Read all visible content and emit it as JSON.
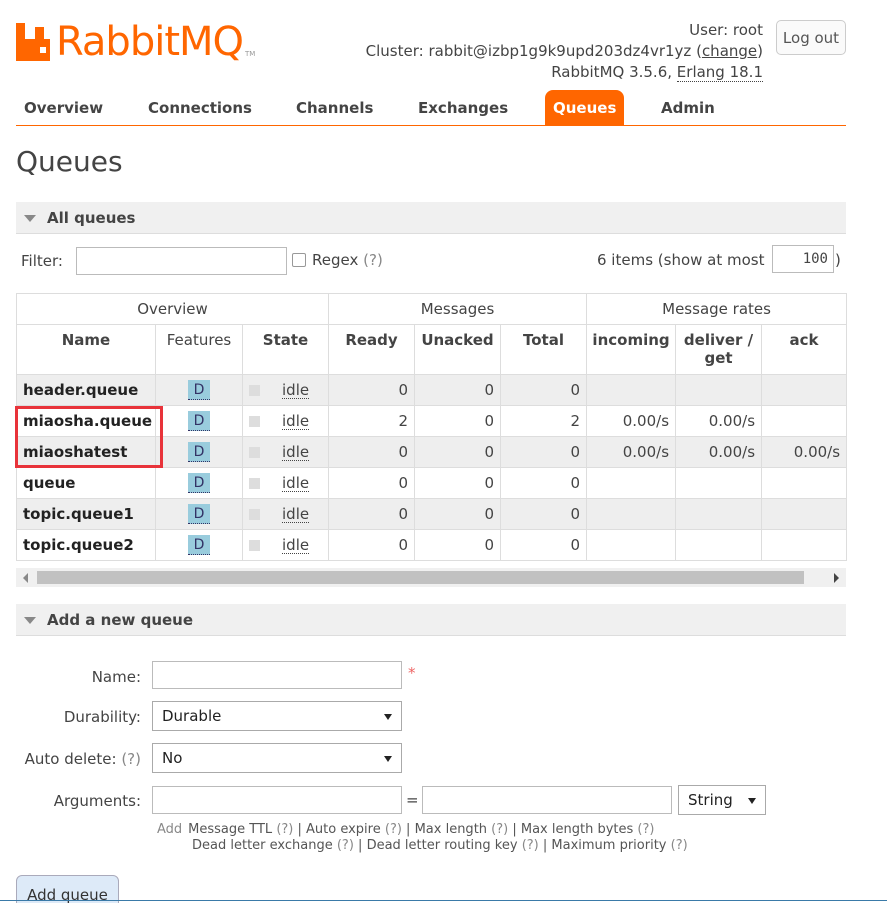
{
  "header": {
    "logo_text": "RabbitMQ",
    "logo_tm": "TM",
    "user_label": "User:",
    "user": "root",
    "cluster_label": "Cluster:",
    "cluster": "rabbit@izbp1g9k9upd203dz4vr1yz",
    "change_link": "change",
    "version": "RabbitMQ 3.5.6,",
    "erlang": "Erlang 18.1",
    "logout": "Log out"
  },
  "nav": {
    "items": [
      "Overview",
      "Connections",
      "Channels",
      "Exchanges",
      "Queues",
      "Admin"
    ],
    "active": "Queues"
  },
  "page_title": "Queues",
  "all_queues": {
    "title": "All queues",
    "filter_label": "Filter:",
    "filter_value": "",
    "regex_label": "Regex",
    "help_mark": "(?)",
    "items_text": "6 items (show at most",
    "items_value": "100",
    "items_close": ")"
  },
  "table": {
    "groups": [
      "Overview",
      "Messages",
      "Message rates"
    ],
    "columns": [
      "Name",
      "Features",
      "State",
      "Ready",
      "Unacked",
      "Total",
      "incoming",
      "deliver / get",
      "ack"
    ],
    "rows": [
      {
        "name": "header.queue",
        "feature": "D",
        "state": "idle",
        "ready": "0",
        "unacked": "0",
        "total": "0",
        "incoming": "",
        "deliver": "",
        "ack": ""
      },
      {
        "name": "miaosha.queue",
        "feature": "D",
        "state": "idle",
        "ready": "2",
        "unacked": "0",
        "total": "2",
        "incoming": "0.00/s",
        "deliver": "0.00/s",
        "ack": ""
      },
      {
        "name": "miaoshatest",
        "feature": "D",
        "state": "idle",
        "ready": "0",
        "unacked": "0",
        "total": "0",
        "incoming": "0.00/s",
        "deliver": "0.00/s",
        "ack": "0.00/s"
      },
      {
        "name": "queue",
        "feature": "D",
        "state": "idle",
        "ready": "0",
        "unacked": "0",
        "total": "0",
        "incoming": "",
        "deliver": "",
        "ack": ""
      },
      {
        "name": "topic.queue1",
        "feature": "D",
        "state": "idle",
        "ready": "0",
        "unacked": "0",
        "total": "0",
        "incoming": "",
        "deliver": "",
        "ack": ""
      },
      {
        "name": "topic.queue2",
        "feature": "D",
        "state": "idle",
        "ready": "0",
        "unacked": "0",
        "total": "0",
        "incoming": "",
        "deliver": "",
        "ack": ""
      }
    ]
  },
  "add_queue": {
    "title": "Add a new queue",
    "name_label": "Name:",
    "name_value": "",
    "required_mark": "*",
    "durability_label": "Durability:",
    "durability_value": "Durable",
    "auto_delete_label": "Auto delete:",
    "auto_delete_help": "(?)",
    "auto_delete_value": "No",
    "arguments_label": "Arguments:",
    "arg_key": "",
    "equals": "=",
    "arg_value": "",
    "arg_type": "String",
    "help_add": "Add",
    "help_line1": [
      {
        "label": "Message TTL",
        "help": "(?)"
      },
      {
        "label": "Auto expire",
        "help": "(?)"
      },
      {
        "label": "Max length",
        "help": "(?)"
      },
      {
        "label": "Max length bytes",
        "help": "(?)"
      }
    ],
    "help_line2": [
      {
        "label": "Dead letter exchange",
        "help": "(?)"
      },
      {
        "label": "Dead letter routing key",
        "help": "(?)"
      },
      {
        "label": "Maximum priority",
        "help": "(?)"
      }
    ],
    "submit": "Add queue"
  },
  "colors": {
    "brand": "#ff6600",
    "highlight_box": "#e8333a",
    "feature_badge": "#99ccdd"
  }
}
